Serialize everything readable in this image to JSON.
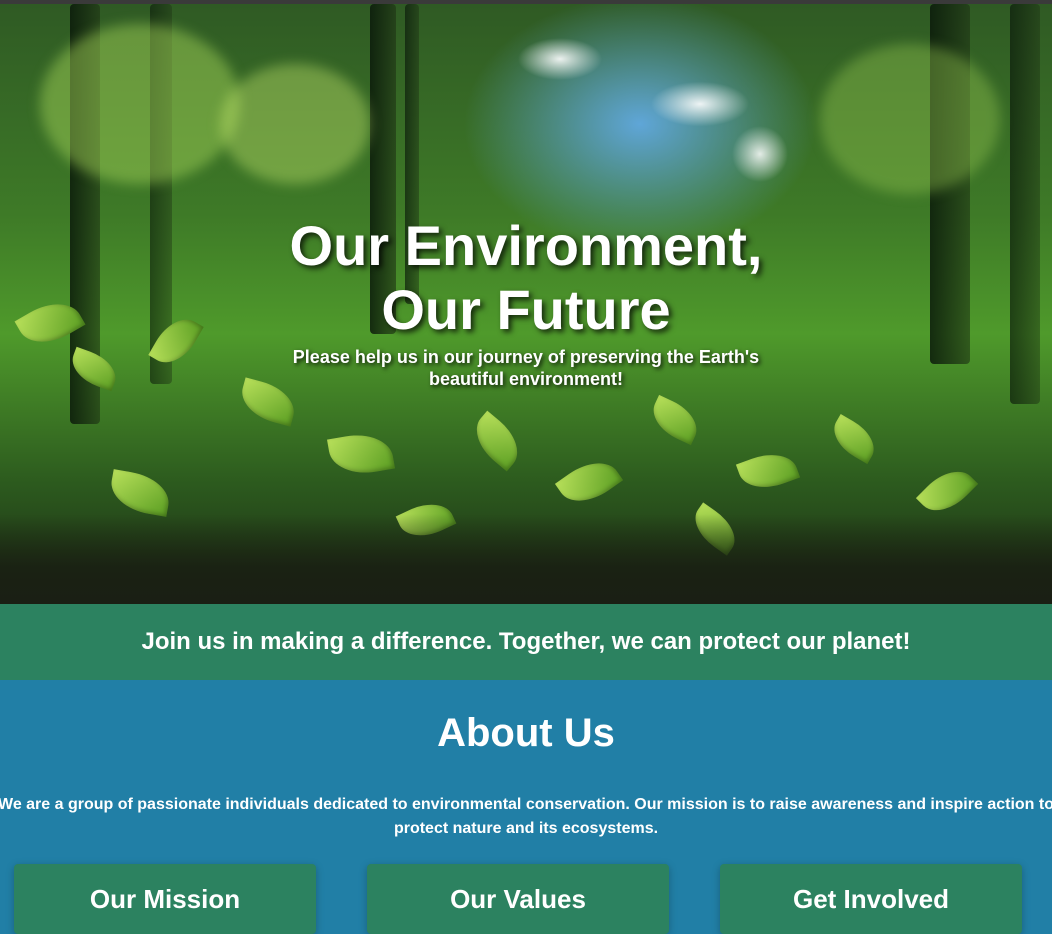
{
  "hero": {
    "title_line1": "Our Environment,",
    "title_line2": "Our Future",
    "subtitle": "Please help us in our journey of preserving the Earth's beautiful environment!"
  },
  "banner": {
    "text": "Join us in making a difference. Together, we can protect our planet!"
  },
  "about": {
    "heading": "About Us",
    "text": "We are a group of passionate individuals dedicated to environmental conservation. Our mission is to raise awareness and inspire action to protect nature and its ecosystems.",
    "cards": [
      {
        "title": "Our Mission"
      },
      {
        "title": "Our Values"
      },
      {
        "title": "Get Involved"
      }
    ]
  },
  "colors": {
    "banner_green": "#2c8260",
    "about_blue": "#217fa6",
    "text_white": "#ffffff"
  }
}
